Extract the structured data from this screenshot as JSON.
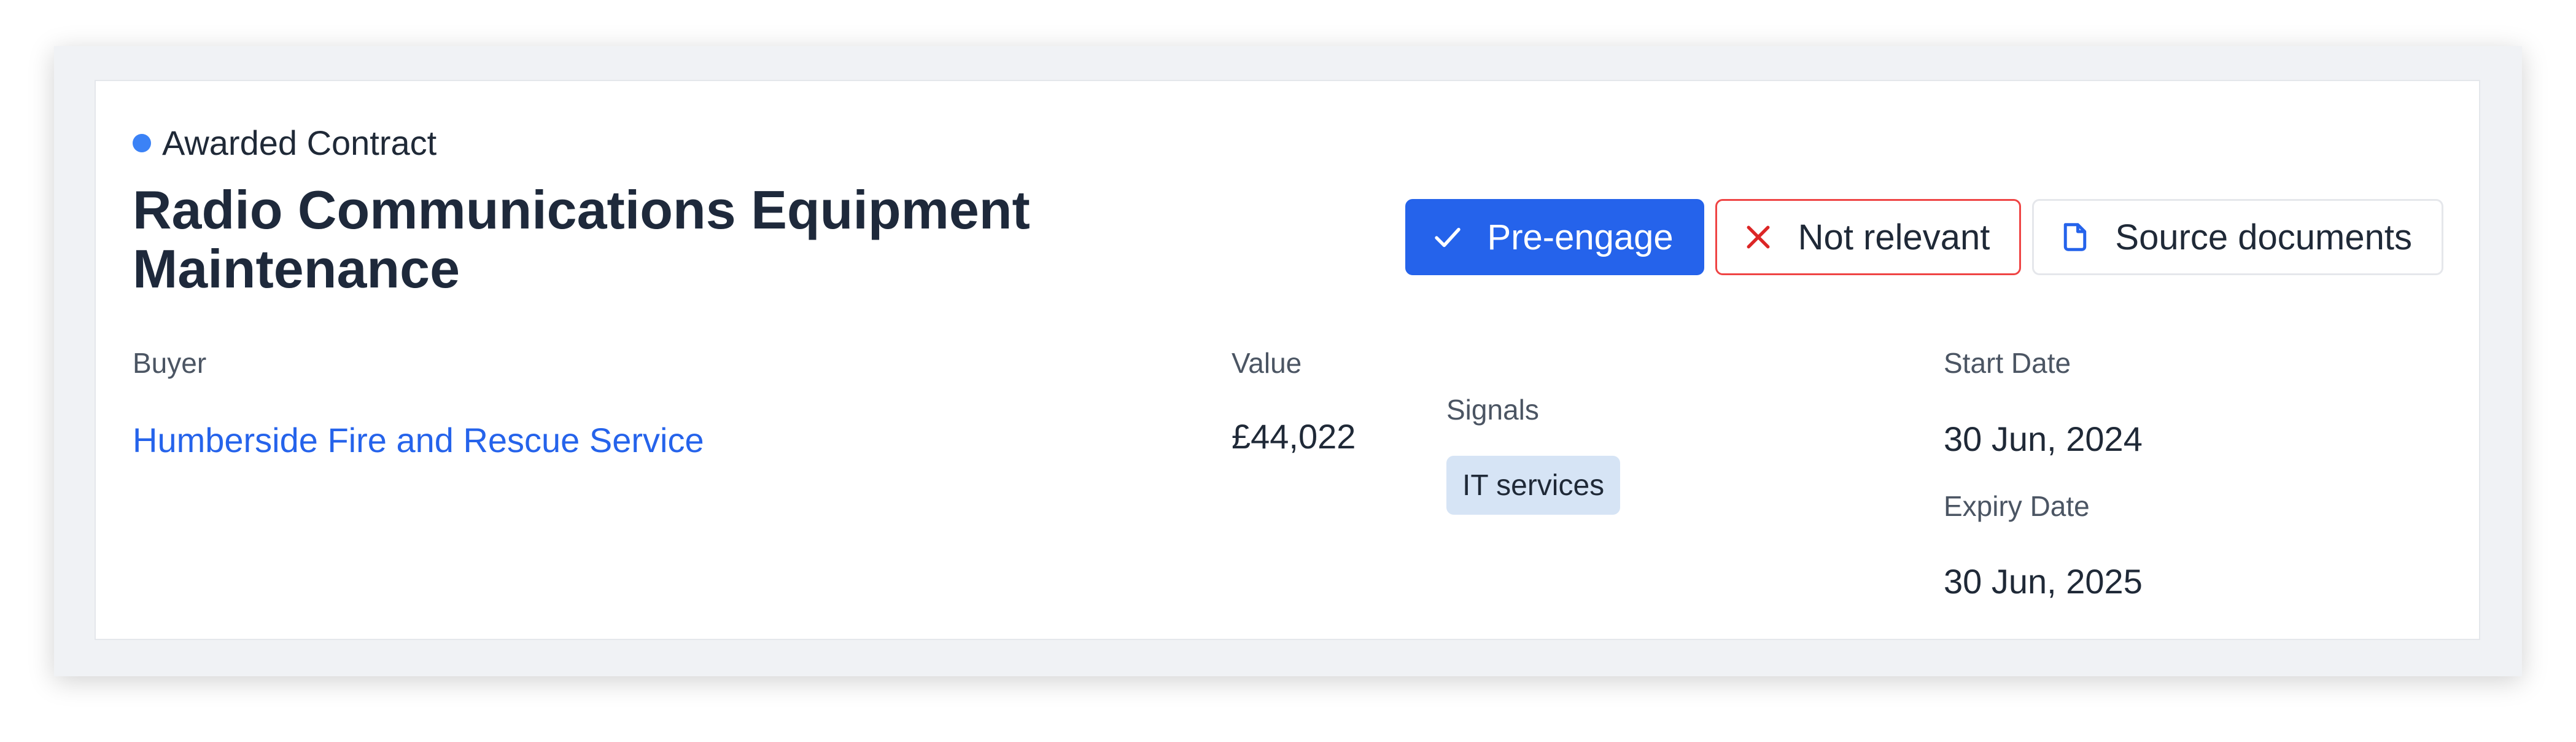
{
  "status": {
    "label": "Awarded Contract",
    "dot_color": "#3b82f6"
  },
  "title": "Radio Communications Equipment Maintenance",
  "actions": {
    "preengage": {
      "label": "Pre-engage",
      "icon": "check-icon"
    },
    "not_relevant": {
      "label": "Not relevant",
      "icon": "close-icon"
    },
    "source_documents": {
      "label": "Source documents",
      "icon": "document-icon"
    }
  },
  "buyer": {
    "label": "Buyer",
    "name": "Humberside Fire and Rescue Service"
  },
  "value": {
    "label": "Value",
    "amount": "£44,022"
  },
  "signals": {
    "label": "Signals",
    "items": [
      "IT services"
    ]
  },
  "dates": {
    "start_label": "Start Date",
    "start_value": "30 Jun, 2024",
    "expiry_label": "Expiry Date",
    "expiry_value": "30 Jun, 2025"
  },
  "colors": {
    "primary": "#2563eb",
    "danger": "#ef4444",
    "chip_bg": "#d6e4f5"
  }
}
